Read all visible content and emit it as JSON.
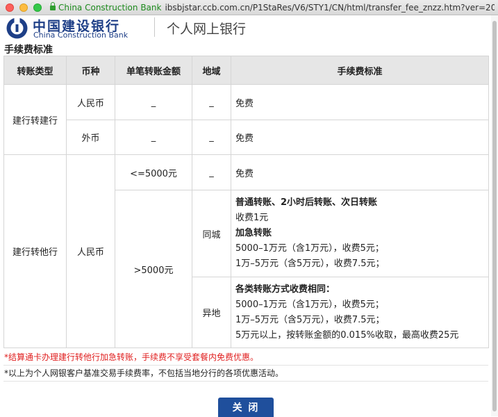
{
  "window": {
    "secure_label": "China Construction Bank",
    "url": "ibsbjstar.ccb.com.cn/P1StaRes/V6/STY1/CN/html/transfer_fee_znzz.htm?ver=20170..."
  },
  "header": {
    "logo_cn": "中国建设银行",
    "logo_en": "China Construction Bank",
    "title": "个人网上银行"
  },
  "section_title": "手续费标准",
  "table": {
    "headers": [
      "转账类型",
      "币种",
      "单笔转账金额",
      "地域",
      "手续费标准"
    ],
    "rows": {
      "ccb_to_ccb": "建行转建行",
      "cny": "人民币",
      "foreign": "外币",
      "dash": "_",
      "free": "免费",
      "ccb_to_other": "建行转他行",
      "le5000": "<=5000元",
      "gt5000": ">5000元",
      "same_city": "同城",
      "other_city": "异地"
    },
    "same_city_detail": {
      "line1": "普通转账、2小时后转账、次日转账",
      "line2": "收费1元",
      "line3": "加急转账",
      "line4": "5000–1万元（含1万元），收费5元；",
      "line5": "1万–5万元（含5万元），收费7.5元；"
    },
    "other_city_detail": {
      "line1": "各类转账方式收费相同：",
      "line2": "5000–1万元（含1万元），收费5元；",
      "line3": "1万–5万元（含5万元），收费7.5元；",
      "line4": "5万元以上，按转账金额的0.015%收取，最高收费25元"
    }
  },
  "notes": {
    "red": "*结算通卡办理建行转他行加急转账，手续费不享受套餐内免费优惠。",
    "gray": "*以上为个人网银客户基准交易手续费率，不包括当地分行的各项优惠活动。"
  },
  "close_button": "关 闭",
  "colors": {
    "brand_blue": "#1e3f87",
    "button_blue": "#1f4f9c",
    "note_red": "#e02020",
    "header_gray": "#e6e6e6"
  }
}
